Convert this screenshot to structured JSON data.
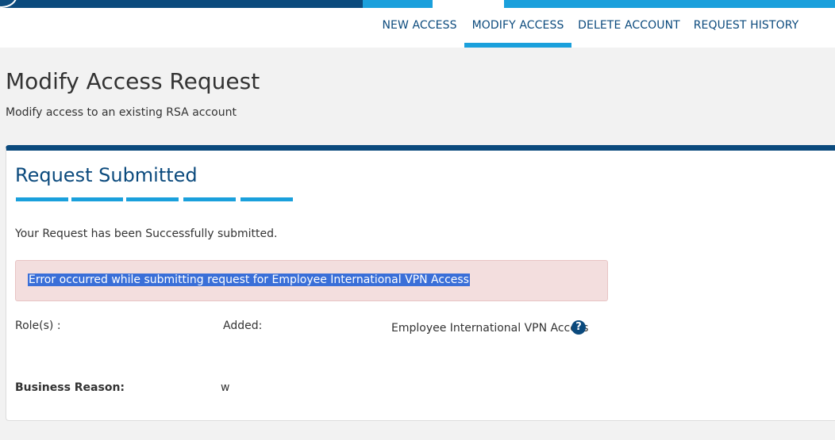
{
  "nav": {
    "tabs": [
      {
        "label": "NEW ACCESS",
        "active": false
      },
      {
        "label": "MODIFY ACCESS",
        "active": true
      },
      {
        "label": "DELETE ACCOUNT",
        "active": false
      },
      {
        "label": "REQUEST HISTORY",
        "active": false
      }
    ]
  },
  "page": {
    "title": "Modify Access Request",
    "subtitle": "Modify access to an existing RSA account"
  },
  "card": {
    "title": "Request Submitted",
    "step_count": 5,
    "success_message": "Your Request has been Successfully submitted.",
    "error_message": "Error occurred while submitting request for Employee International VPN Access",
    "roles_label": "Role(s) :",
    "added_label": "Added:",
    "role_value": "Employee International VPN Access",
    "help_icon": "?",
    "business_reason_label": "Business Reason:",
    "business_reason_value": "w"
  },
  "colors": {
    "brand_dark": "#0b4a7d",
    "accent": "#1aa0dc",
    "error_bg": "#f3dede",
    "selection": "#3a6fd8"
  }
}
